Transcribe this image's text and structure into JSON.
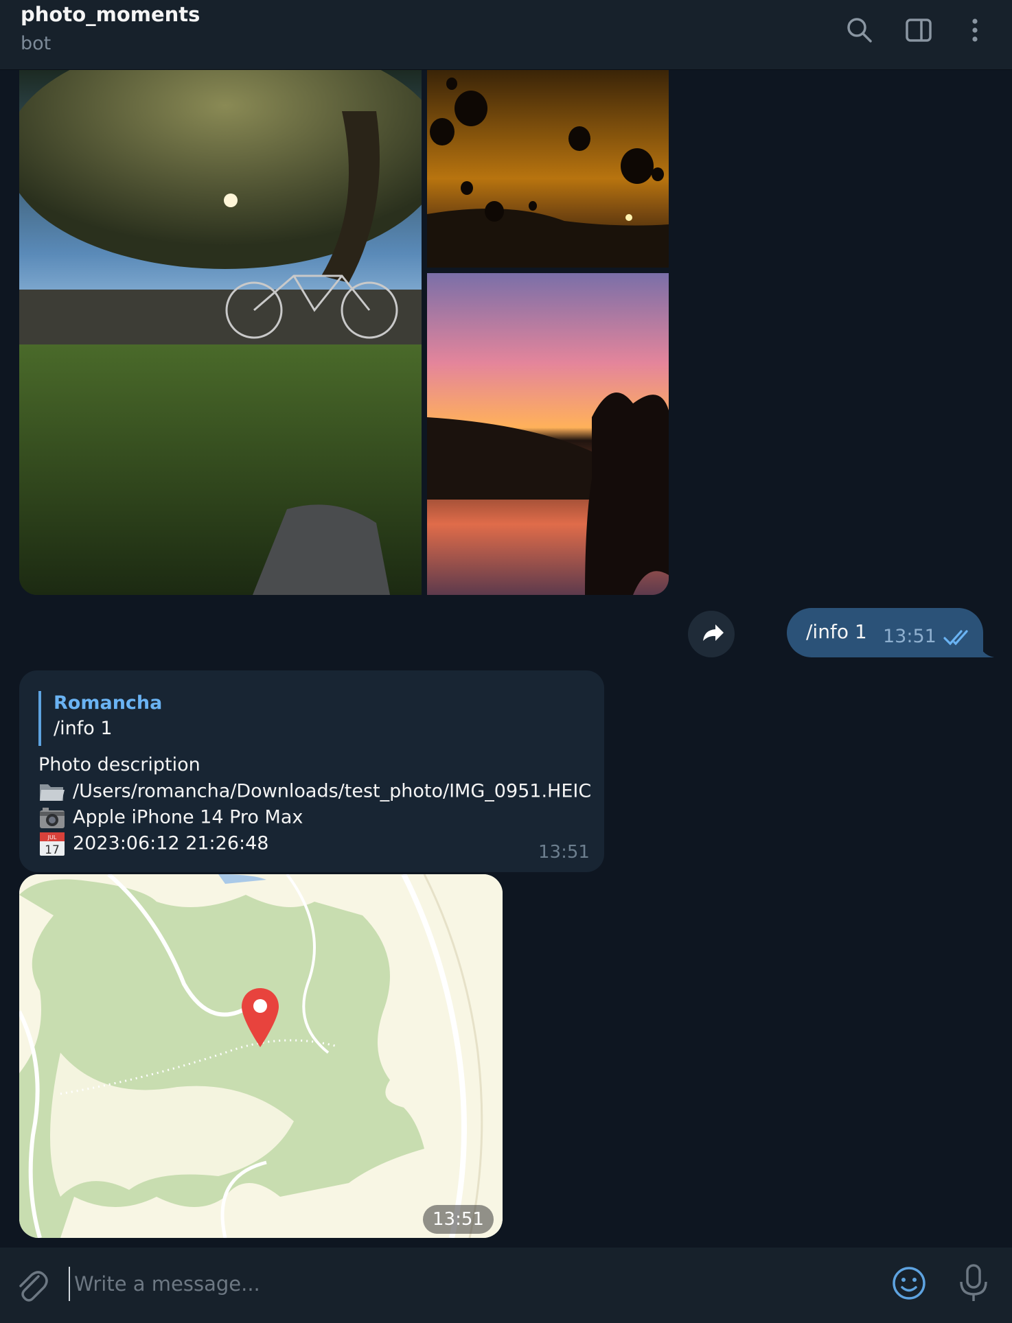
{
  "header": {
    "title": "photo_moments",
    "subtitle": "bot",
    "icons": [
      "search-icon",
      "sidebar-toggle-icon",
      "more-vertical-icon"
    ]
  },
  "album": {
    "photos": [
      "garden-bicycle-night-photo",
      "hot-air-balloons-sunset-photo",
      "pink-sunset-lake-photo"
    ]
  },
  "outgoing": {
    "text": "/info 1",
    "time": "13:51",
    "status_icon": "double-check-icon"
  },
  "incoming": {
    "reply_author": "Romancha",
    "reply_text": "/info 1",
    "lines": [
      {
        "icon": "",
        "text": "Photo description"
      },
      {
        "icon": "folder-icon",
        "text": "/Users/romancha/Downloads/test_photo/IMG_0951.HEIC"
      },
      {
        "icon": "camera-icon",
        "text": "Apple iPhone 14 Pro Max"
      },
      {
        "icon": "calendar-icon",
        "calendar_month": "JUL",
        "calendar_day": "17",
        "text": "2023:06:12 21:26:48"
      }
    ],
    "time": "13:51"
  },
  "location": {
    "time": "13:51",
    "marker_icon": "map-pin-icon"
  },
  "composer": {
    "placeholder": "Write a message..."
  },
  "colors": {
    "background": "#0e1621",
    "header": "#17212b",
    "outgoing_bubble": "#2b5278",
    "incoming_bubble": "#182533",
    "accent": "#6ab3f3",
    "pin": "#e8433d"
  }
}
